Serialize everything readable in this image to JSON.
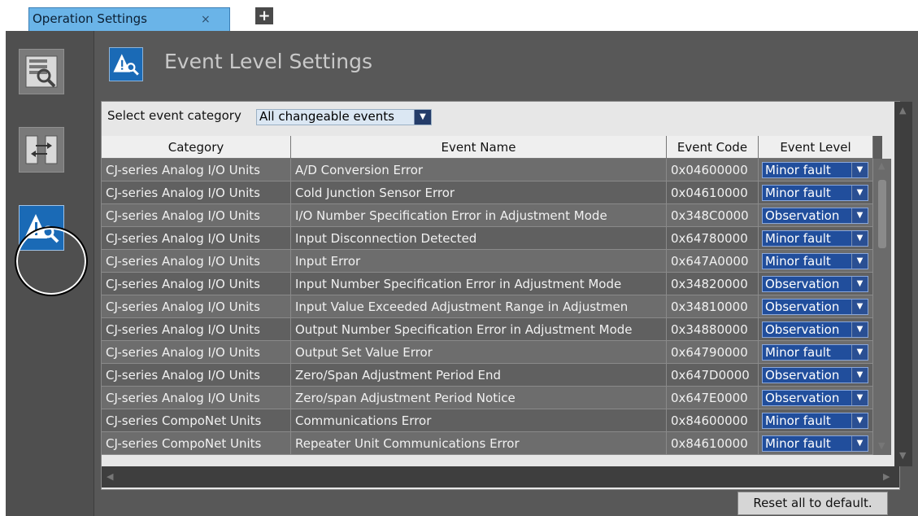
{
  "tab": {
    "label": "Operation Settings",
    "close": "×",
    "add": "+"
  },
  "header": {
    "title": "Event Level Settings"
  },
  "filter": {
    "label": "Select event category",
    "value": "All changeable events"
  },
  "table": {
    "headers": [
      "Category",
      "Event Name",
      "Event Code",
      "Event Level"
    ],
    "rows": [
      {
        "category": "CJ-series Analog I/O Units",
        "name": "A/D Conversion Error",
        "code": "0x04600000",
        "level": "Minor fault"
      },
      {
        "category": "CJ-series Analog I/O Units",
        "name": "Cold Junction Sensor Error",
        "code": "0x04610000",
        "level": "Minor fault"
      },
      {
        "category": "CJ-series Analog I/O Units",
        "name": "I/O Number Specification Error in Adjustment Mode",
        "code": "0x348C0000",
        "level": "Observation"
      },
      {
        "category": "CJ-series Analog I/O Units",
        "name": "Input Disconnection Detected",
        "code": "0x64780000",
        "level": "Minor fault"
      },
      {
        "category": "CJ-series Analog I/O Units",
        "name": "Input Error",
        "code": "0x647A0000",
        "level": "Minor fault"
      },
      {
        "category": "CJ-series Analog I/O Units",
        "name": "Input Number Specification Error in Adjustment Mode",
        "code": "0x34820000",
        "level": "Observation"
      },
      {
        "category": "CJ-series Analog I/O Units",
        "name": "Input Value Exceeded Adjustment Range in Adjustmen",
        "code": "0x34810000",
        "level": "Observation"
      },
      {
        "category": "CJ-series Analog I/O Units",
        "name": "Output Number Specification Error in Adjustment Mode",
        "code": "0x34880000",
        "level": "Observation"
      },
      {
        "category": "CJ-series Analog I/O Units",
        "name": "Output Set Value Error",
        "code": "0x64790000",
        "level": "Minor fault"
      },
      {
        "category": "CJ-series Analog I/O Units",
        "name": "Zero/Span Adjustment Period End",
        "code": "0x647D0000",
        "level": "Observation"
      },
      {
        "category": "CJ-series Analog I/O Units",
        "name": "Zero/span Adjustment Period Notice",
        "code": "0x647E0000",
        "level": "Observation"
      },
      {
        "category": "CJ-series CompoNet Units",
        "name": "Communications Error",
        "code": "0x84600000",
        "level": "Minor fault"
      },
      {
        "category": "CJ-series CompoNet Units",
        "name": "Repeater Unit Communications Error",
        "code": "0x84610000",
        "level": "Minor fault"
      }
    ]
  },
  "footer": {
    "reset_label": "Reset all to default."
  },
  "icons": {
    "sidebar": [
      "io-map-icon",
      "sync-icon",
      "event-level-icon"
    ],
    "header": "event-level-icon"
  },
  "colors": {
    "tab_active": "#6ab4e8",
    "select_blue": "#214e9c",
    "panel_bg": "#585858"
  }
}
